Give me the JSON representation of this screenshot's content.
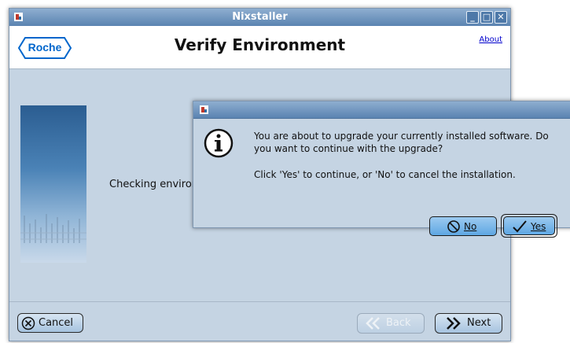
{
  "window": {
    "title": "Nixstaller",
    "minimize_label": "_",
    "maximize_label": "□",
    "close_label": "✕"
  },
  "header": {
    "logo_text": "Roche",
    "page_title": "Verify Environment",
    "about_link": "About"
  },
  "main": {
    "status_text": "Checking environment..."
  },
  "footer": {
    "cancel_label": "Cancel",
    "back_label": "Back",
    "next_label": "Next"
  },
  "dialog": {
    "message_line1": "You are about to upgrade your currently installed software. Do",
    "message_line2": "you want to continue with the upgrade?",
    "message_line3": "Click 'Yes' to continue, or 'No' to cancel the installation.",
    "no_label": "No",
    "yes_label": "Yes"
  },
  "icons": [
    "app-icon",
    "info-icon",
    "cancel-icon",
    "back-icon",
    "next-icon",
    "no-icon",
    "yes-icon"
  ],
  "colors": {
    "titlebar": "#5a83b1",
    "background": "#c5d4e3",
    "dialog_button": "#7fbaea",
    "logo": "#0066cc"
  }
}
